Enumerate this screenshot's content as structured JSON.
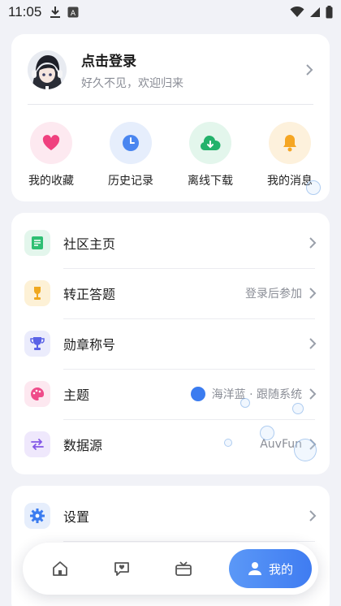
{
  "status_bar": {
    "time": "11:05"
  },
  "profile": {
    "title": "点击登录",
    "subtitle": "好久不见，欢迎归来"
  },
  "quick_actions": [
    {
      "label": "我的收藏",
      "icon": "heart-icon",
      "color": "#f0417f",
      "bg": "#fde9f0"
    },
    {
      "label": "历史记录",
      "icon": "clock-icon",
      "color": "#4a86f0",
      "bg": "#e6eefc"
    },
    {
      "label": "离线下载",
      "icon": "cloud-download-icon",
      "color": "#23b26b",
      "bg": "#e3f6ec"
    },
    {
      "label": "我的消息",
      "icon": "bell-icon",
      "color": "#f5a623",
      "bg": "#fdf1dc"
    }
  ],
  "menu": [
    {
      "label": "社区主页",
      "icon": "document-icon",
      "color": "#2fbf73",
      "bg": "#e3f6ec",
      "value": ""
    },
    {
      "label": "转正答题",
      "icon": "trophy-icon",
      "color": "#f0a81e",
      "bg": "#fdf1d6",
      "value": "登录后参加"
    },
    {
      "label": "勋章称号",
      "icon": "cup-icon",
      "color": "#5b63e6",
      "bg": "#ebecfc",
      "value": ""
    },
    {
      "label": "主题",
      "icon": "palette-icon",
      "color": "#ef4c8a",
      "bg": "#fde8f0",
      "value": "海洋蓝 · 跟随系统"
    },
    {
      "label": "数据源",
      "icon": "swap-icon",
      "color": "#8357e6",
      "bg": "#efe8fc",
      "value": "AuvFun"
    }
  ],
  "settings": {
    "label": "设置",
    "icon": "gear-icon",
    "color": "#3b7cf0",
    "bg": "#e6eefc"
  },
  "nav": {
    "active_label": "我的",
    "accent": "#4a86f3"
  }
}
